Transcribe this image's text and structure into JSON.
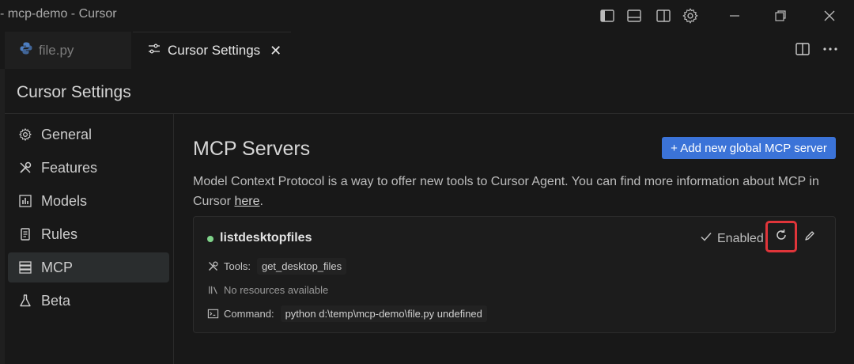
{
  "window": {
    "title": "- mcp-demo - Cursor",
    "icons": [
      "layout-sidebar-left-icon",
      "layout-panel-icon",
      "layout-sidebar-right-icon",
      "gear-icon",
      "minimize-icon",
      "restore-icon",
      "close-icon"
    ]
  },
  "tabs": [
    {
      "label": "file.py",
      "icon": "python-icon",
      "active": false
    },
    {
      "label": "Cursor Settings",
      "icon": "settings-sliders-icon",
      "active": true,
      "close": "✕"
    }
  ],
  "settings": {
    "title": "Cursor Settings",
    "nav": [
      {
        "label": "General",
        "icon": "gear-icon"
      },
      {
        "label": "Features",
        "icon": "tools-icon"
      },
      {
        "label": "Models",
        "icon": "bar-chart-icon"
      },
      {
        "label": "Rules",
        "icon": "document-icon"
      },
      {
        "label": "MCP",
        "icon": "server-icon",
        "active": true
      },
      {
        "label": "Beta",
        "icon": "flask-icon"
      }
    ]
  },
  "mcp": {
    "heading": "MCP Servers",
    "add_button": "+ Add new global MCP server",
    "description": "Model Context Protocol is a way to offer new tools to Cursor Agent. You can find more information about MCP in Cursor",
    "link_text": "here",
    "period": ".",
    "server": {
      "name": "listdesktopfiles",
      "status_color": "#7fd38a",
      "enabled_label": "Enabled",
      "tools_label": "Tools:",
      "tools_value": "get_desktop_files",
      "resources_text": "No resources available",
      "command_label": "Command:",
      "command_value": "python d:\\temp\\mcp-demo\\file.py undefined"
    }
  },
  "colors": {
    "accent": "#3b73d8",
    "highlight": "#e0353a",
    "background": "#181818"
  }
}
